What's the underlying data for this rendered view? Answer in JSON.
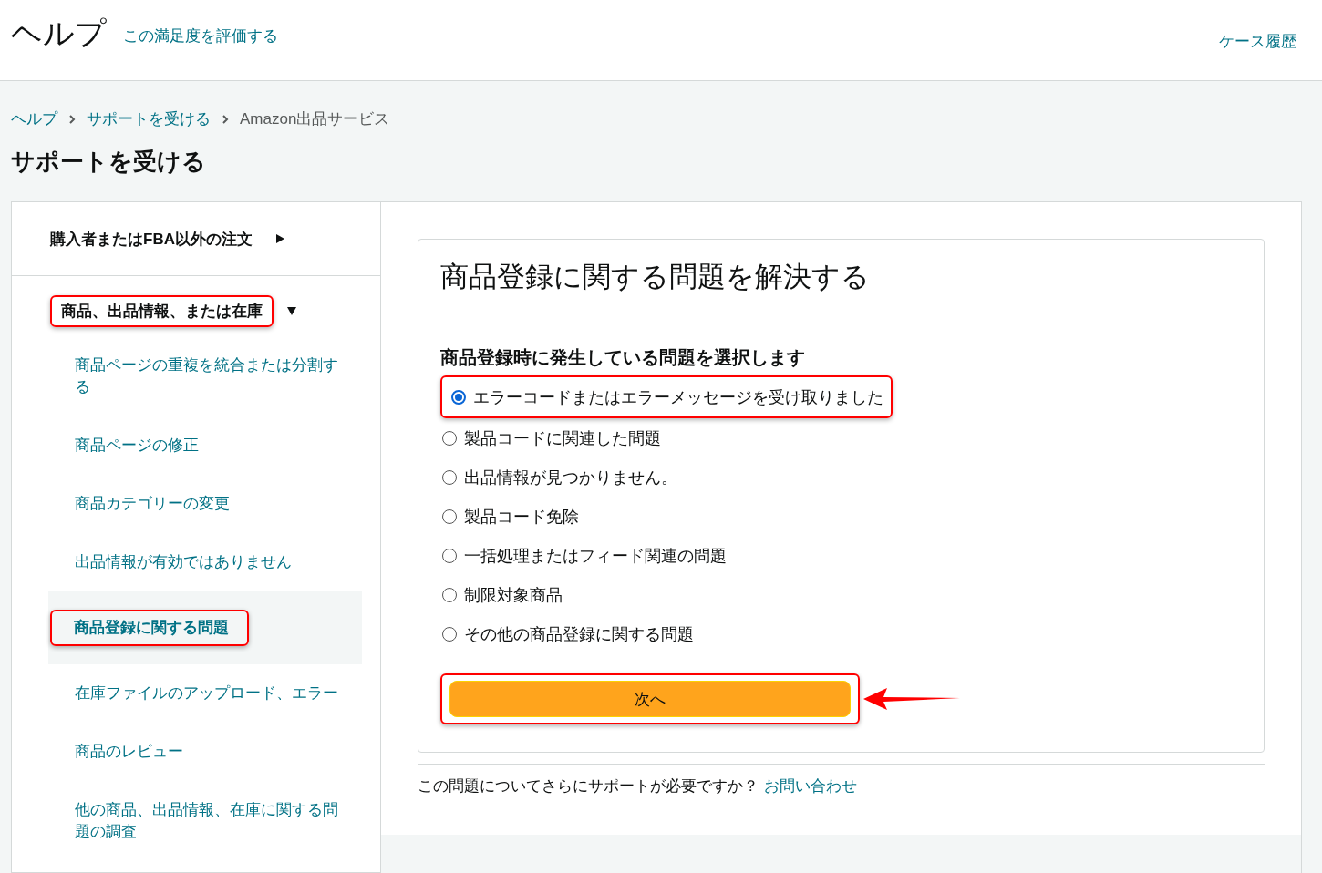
{
  "header": {
    "title": "ヘルプ",
    "rate_link": "この満足度を評価する",
    "case_history_link": "ケース履歴"
  },
  "breadcrumb": [
    {
      "label": "ヘルプ",
      "link": true
    },
    {
      "label": "サポートを受ける",
      "link": true
    },
    {
      "label": "Amazon出品サービス",
      "link": false
    }
  ],
  "page_title": "サポートを受ける",
  "sidebar": {
    "categories": [
      {
        "label": "購入者またはFBA以外の注文",
        "expanded": false,
        "highlighted": false
      },
      {
        "label": "商品、出品情報、または在庫",
        "expanded": true,
        "highlighted": true,
        "children": [
          {
            "label": "商品ページの重複を統合または分割する",
            "selected": false,
            "highlighted": false
          },
          {
            "label": "商品ページの修正",
            "selected": false,
            "highlighted": false
          },
          {
            "label": "商品カテゴリーの変更",
            "selected": false,
            "highlighted": false
          },
          {
            "label": "出品情報が有効ではありません",
            "selected": false,
            "highlighted": false
          },
          {
            "label": "商品登録に関する問題",
            "selected": true,
            "highlighted": true
          },
          {
            "label": "在庫ファイルのアップロード、エラー",
            "selected": false,
            "highlighted": false
          },
          {
            "label": "商品のレビュー",
            "selected": false,
            "highlighted": false
          },
          {
            "label": "他の商品、出品情報、在庫に関する問題の調査",
            "selected": false,
            "highlighted": false
          }
        ]
      }
    ]
  },
  "main": {
    "title": "商品登録に関する問題を解決する",
    "question": "商品登録時に発生している問題を選択します",
    "options": [
      {
        "label": "エラーコードまたはエラーメッセージを受け取りました",
        "selected": true,
        "highlighted": true
      },
      {
        "label": "製品コードに関連した問題",
        "selected": false,
        "highlighted": false
      },
      {
        "label": "出品情報が見つかりません。",
        "selected": false,
        "highlighted": false
      },
      {
        "label": "製品コード免除",
        "selected": false,
        "highlighted": false
      },
      {
        "label": "一括処理またはフィード関連の問題",
        "selected": false,
        "highlighted": false
      },
      {
        "label": "制限対象商品",
        "selected": false,
        "highlighted": false
      },
      {
        "label": "その他の商品登録に関する問題",
        "selected": false,
        "highlighted": false
      }
    ],
    "next_button": {
      "label": "次へ",
      "highlighted": true,
      "pointer_arrow": true
    },
    "footer": {
      "text": "この問題についてさらにサポートが必要ですか？",
      "link": "お問い合わせ"
    }
  }
}
